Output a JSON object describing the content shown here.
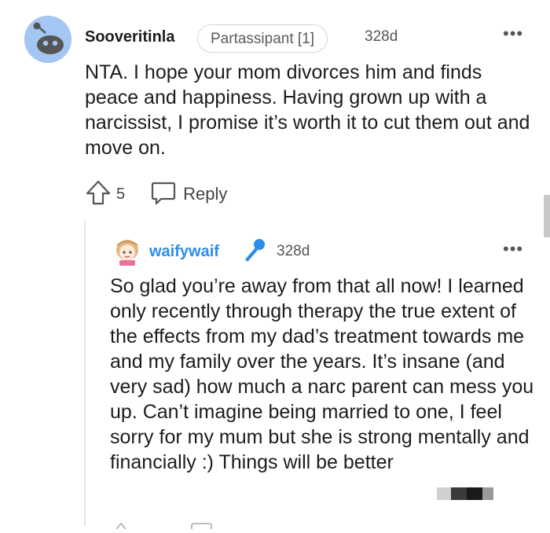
{
  "comment": {
    "username": "Sooveritinla",
    "flair": "Partassipant [1]",
    "time": "328d",
    "more_label": "•••",
    "body": "NTA. I hope your mom divorces him and finds peace and happiness. Having grown up with a narcissist, I promise it’s worth it to cut them out and move on.",
    "votes": "5",
    "reply_label": "Reply"
  },
  "reply": {
    "username": "waifywaif",
    "time": "328d",
    "more_label": "•••",
    "body": "So glad you’re away from that all now! I learned only recently through therapy the true extent of the effects from my dad’s treatment towards me and my family over the years. It’s insane (and very sad) how much a narc parent can mess you up. Can’t imagine being married to one, I feel sorry for my mum but she is strong mentally and financially :) Things will be better"
  },
  "colors": {
    "username_reply": "#2a8ee8",
    "avatar_bg": "#a3c6f2",
    "mod_icon": "#2a8ee8"
  },
  "icons": [
    "reddit-avatar-icon",
    "upvote-icon",
    "comment-bubble-icon",
    "anime-avatar-icon",
    "microphone-icon",
    "more-options-icon"
  ]
}
